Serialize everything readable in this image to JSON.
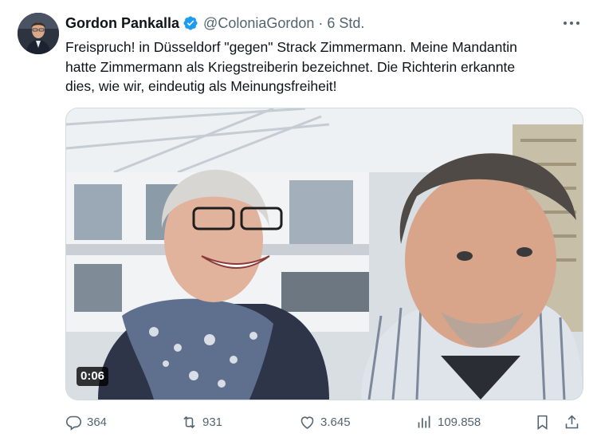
{
  "author": {
    "name": "Gordon Pankalla",
    "handle": "@ColoniaGordon",
    "separator": "·",
    "time": "6 Std.",
    "verified": true
  },
  "tweet": {
    "text_lines": [
      "Freispruch! in Düsseldorf \"gegen\" Strack Zimmermann. Meine Mandantin",
      "hatte Zimmermann als Kriegstreiberin bezeichnet. Die Richterin erkannte",
      "dies, wie wir, eindeutig als Meinungsfreiheit!"
    ]
  },
  "media": {
    "type": "video",
    "duration": "0:06"
  },
  "actions": {
    "replies": "364",
    "reposts": "931",
    "likes": "3.645",
    "views": "109.858"
  },
  "icons": {
    "more": "more-icon",
    "verified": "verified-badge-icon",
    "reply": "reply-icon",
    "repost": "repost-icon",
    "like": "heart-icon",
    "views": "views-chart-icon",
    "bookmark": "bookmark-icon",
    "share": "share-icon"
  },
  "colors": {
    "verified": "#1d9bf0",
    "secondary_text": "#536471",
    "primary_text": "#0f1419"
  }
}
